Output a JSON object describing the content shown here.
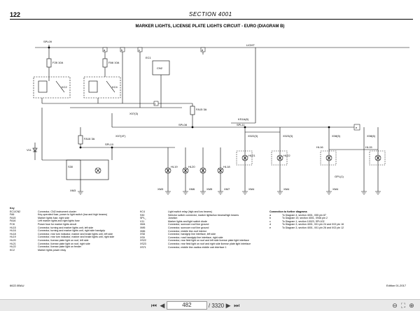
{
  "header": {
    "page_number": "122",
    "section": "SECTION 4001"
  },
  "title": "MARKER LIGHTS, LICENSE PLATE LIGHTS CIRCUIT - EURO (DIAGRAM B)",
  "diagram": {
    "splices": [
      "SPL09",
      "SPL08",
      "SPL11",
      "SPL10"
    ],
    "fuses": [
      "F28\n10A",
      "FA6\n10A",
      "FA15\n3A",
      "FA16\n3A"
    ],
    "relays": [
      "KC2",
      "KC4"
    ],
    "components": [
      "EC1",
      "CN2",
      "S30",
      "V11",
      "HL21",
      "HL22",
      "HL16",
      "HL15",
      "HL19",
      "HL20",
      "HL18"
    ],
    "connectors": [
      "X07(3)",
      "X07(4T)",
      "X02(AT)",
      "X022(3)",
      "X023(3)",
      "X08(5)",
      "X08(6)",
      "XM3",
      "XM3",
      "XM4",
      "XM4",
      "XM4",
      "XM6",
      "XM5",
      "XM7",
      "X5(5)",
      "X5(4)",
      "X04(2)",
      "X022(1)",
      "X023(1)",
      "XPL(2)",
      "XPL(3)",
      "XM6",
      "XM7",
      "XS9(1)"
    ],
    "terminals": [
      "a",
      "b",
      "c",
      "d",
      "e",
      "f"
    ],
    "right_label": "LIGHT",
    "other_labels": [
      "KS1A(8)",
      "GPL(1)",
      "B",
      "B"
    ]
  },
  "legend": {
    "title": "Key",
    "col1": [
      [
        "EC1/CN2",
        "Connector, CN2 instrument cluster"
      ],
      [
        "FA6",
        "Key-operated fuse, power to light switch (low and high beams)"
      ],
      [
        "FA15",
        "Marker lights fuse, right side"
      ],
      [
        "FA16",
        "Left marker lights and right lights fuse"
      ],
      [
        "FC8",
        "Power fuse for marker lights circuit"
      ],
      [
        "HL15",
        "Connector, turning and marker lights unit, left side"
      ],
      [
        "HL16",
        "Connector, turning and marker lights unit, right side handgrip"
      ],
      [
        "HL18",
        "Connector, rear turn indicator, marker and brake lights unit, left side"
      ],
      [
        "HL19",
        "Connector, rear turn indicator, marker and brake lights unit, right side"
      ],
      [
        "HL20",
        "Connector, license plate light on roof, left side"
      ],
      [
        "HL21",
        "Connector, license plate light on roof, right side"
      ],
      [
        "HL22",
        "Connector, license plate light on fender"
      ],
      [
        "KC2",
        "Marker lights power relay"
      ]
    ],
    "col2": [
      [
        "KC4",
        "Light switch relay (high and low beams)"
      ],
      [
        "S30",
        "Selector switch connector, marker lights/low beams/high beams"
      ],
      [
        "SPL_",
        "Junction"
      ],
      [
        "V11",
        "Marker lights and light switch diode"
      ],
      [
        "XM4",
        "Connector, sunroom roof line ground"
      ],
      [
        "XM5",
        "Connector, sunroom roof line ground"
      ],
      [
        "XM6",
        "Connector, middle line-roof interior"
      ],
      [
        "XS8",
        "Connector, handgrip line interface, left side"
      ],
      [
        "XS9",
        "Connector, road handgrip line interface, right side"
      ],
      [
        "XS22",
        "Connector, rear field light on roof and left side license plate light interface"
      ],
      [
        "XS23",
        "Connector, rear field light on roof and right side license plate light interface"
      ],
      [
        "XS71",
        "Connector, middle line-nadius middle cab interface 1"
      ]
    ],
    "col3_title": "Connection to further diagrams",
    "col3": [
      [
        "a",
        "To Diagram 4, section 4001, X55 pin 87"
      ],
      [
        "b",
        "To Diagram 19, section 4001, X946 pin 2"
      ],
      [
        "c",
        "To Diagram 1, section 10023, SPL102"
      ],
      [
        "d",
        "To Diagram 3, section 4001, X01 pin 24 and X02 pin 16"
      ],
      [
        "e",
        "To Diagram 3, section 4001, X01 pin 26 and X02 pin 12"
      ]
    ]
  },
  "footer": {
    "left": "6622.0BAU",
    "right": "Edition 01-2017"
  },
  "viewer": {
    "current_page": "482",
    "total_pages": "/ 3320"
  }
}
